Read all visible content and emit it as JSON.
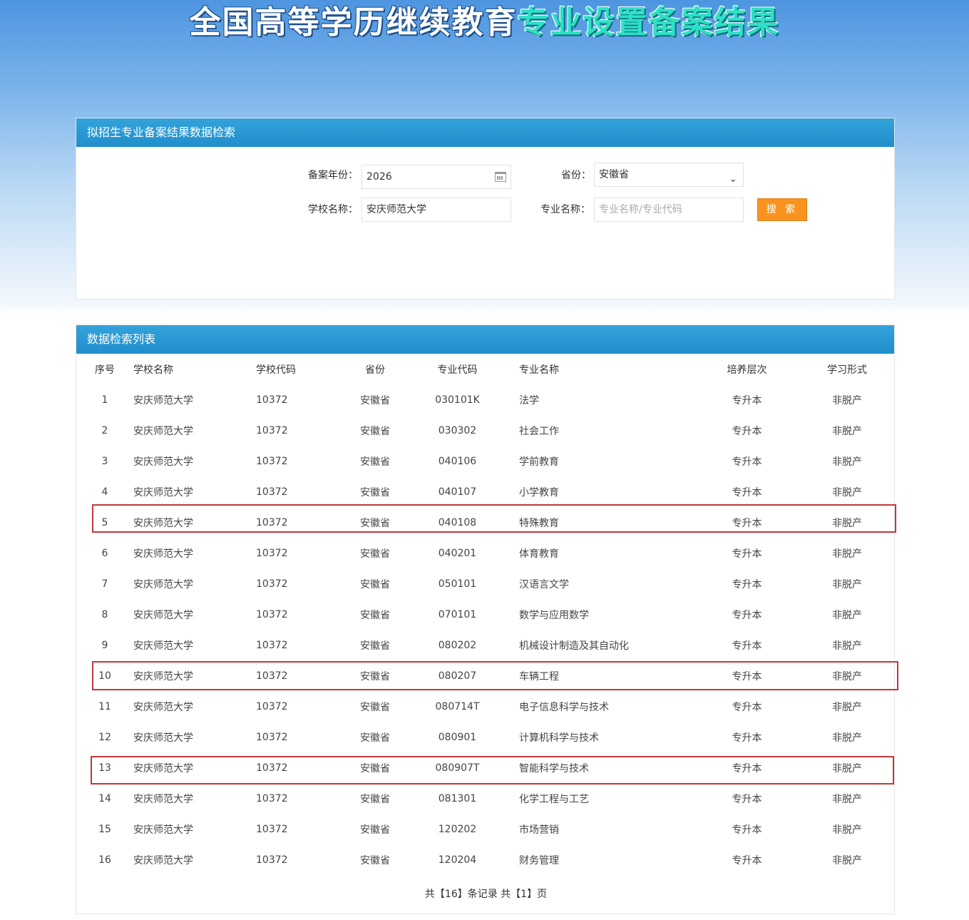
{
  "banner": {
    "title_white": "全国高等学历继续教育",
    "title_green": "专业设置备案结果"
  },
  "search": {
    "header": "拟招生专业备案结果数据检索",
    "year_label": "备案年份：",
    "year_value": "2026",
    "province_label": "省份：",
    "province_value": "安徽省",
    "school_label": "学校名称：",
    "school_value": "安庆师范大学",
    "major_label": "专业名称：",
    "major_placeholder": "专业名称/专业代码",
    "search_button": "搜 索"
  },
  "list": {
    "header": "数据检索列表",
    "columns": [
      "序号",
      "学校名称",
      "学校代码",
      "省份",
      "专业代码",
      "专业名称",
      "培养层次",
      "学习形式"
    ],
    "rows": [
      [
        "1",
        "安庆师范大学",
        "10372",
        "安徽省",
        "030101K",
        "法学",
        "专升本",
        "非脱产"
      ],
      [
        "2",
        "安庆师范大学",
        "10372",
        "安徽省",
        "030302",
        "社会工作",
        "专升本",
        "非脱产"
      ],
      [
        "3",
        "安庆师范大学",
        "10372",
        "安徽省",
        "040106",
        "学前教育",
        "专升本",
        "非脱产"
      ],
      [
        "4",
        "安庆师范大学",
        "10372",
        "安徽省",
        "040107",
        "小学教育",
        "专升本",
        "非脱产"
      ],
      [
        "5",
        "安庆师范大学",
        "10372",
        "安徽省",
        "040108",
        "特殊教育",
        "专升本",
        "非脱产"
      ],
      [
        "6",
        "安庆师范大学",
        "10372",
        "安徽省",
        "040201",
        "体育教育",
        "专升本",
        "非脱产"
      ],
      [
        "7",
        "安庆师范大学",
        "10372",
        "安徽省",
        "050101",
        "汉语言文学",
        "专升本",
        "非脱产"
      ],
      [
        "8",
        "安庆师范大学",
        "10372",
        "安徽省",
        "070101",
        "数学与应用数学",
        "专升本",
        "非脱产"
      ],
      [
        "9",
        "安庆师范大学",
        "10372",
        "安徽省",
        "080202",
        "机械设计制造及其自动化",
        "专升本",
        "非脱产"
      ],
      [
        "10",
        "安庆师范大学",
        "10372",
        "安徽省",
        "080207",
        "车辆工程",
        "专升本",
        "非脱产"
      ],
      [
        "11",
        "安庆师范大学",
        "10372",
        "安徽省",
        "080714T",
        "电子信息科学与技术",
        "专升本",
        "非脱产"
      ],
      [
        "12",
        "安庆师范大学",
        "10372",
        "安徽省",
        "080901",
        "计算机科学与技术",
        "专升本",
        "非脱产"
      ],
      [
        "13",
        "安庆师范大学",
        "10372",
        "安徽省",
        "080907T",
        "智能科学与技术",
        "专升本",
        "非脱产"
      ],
      [
        "14",
        "安庆师范大学",
        "10372",
        "安徽省",
        "081301",
        "化学工程与工艺",
        "专升本",
        "非脱产"
      ],
      [
        "15",
        "安庆师范大学",
        "10372",
        "安徽省",
        "120202",
        "市场营销",
        "专升本",
        "非脱产"
      ],
      [
        "16",
        "安庆师范大学",
        "10372",
        "安徽省",
        "120204",
        "财务管理",
        "专升本",
        "非脱产"
      ]
    ],
    "highlighted_rows": [
      "5",
      "10",
      "13"
    ],
    "pagination": "共【16】条记录 共【1】页"
  },
  "colors": {
    "header_blue": "#2196d3",
    "button_orange": "#f7931e",
    "highlight_red": "#c0393b",
    "banner_green": "#2ee0c4"
  }
}
